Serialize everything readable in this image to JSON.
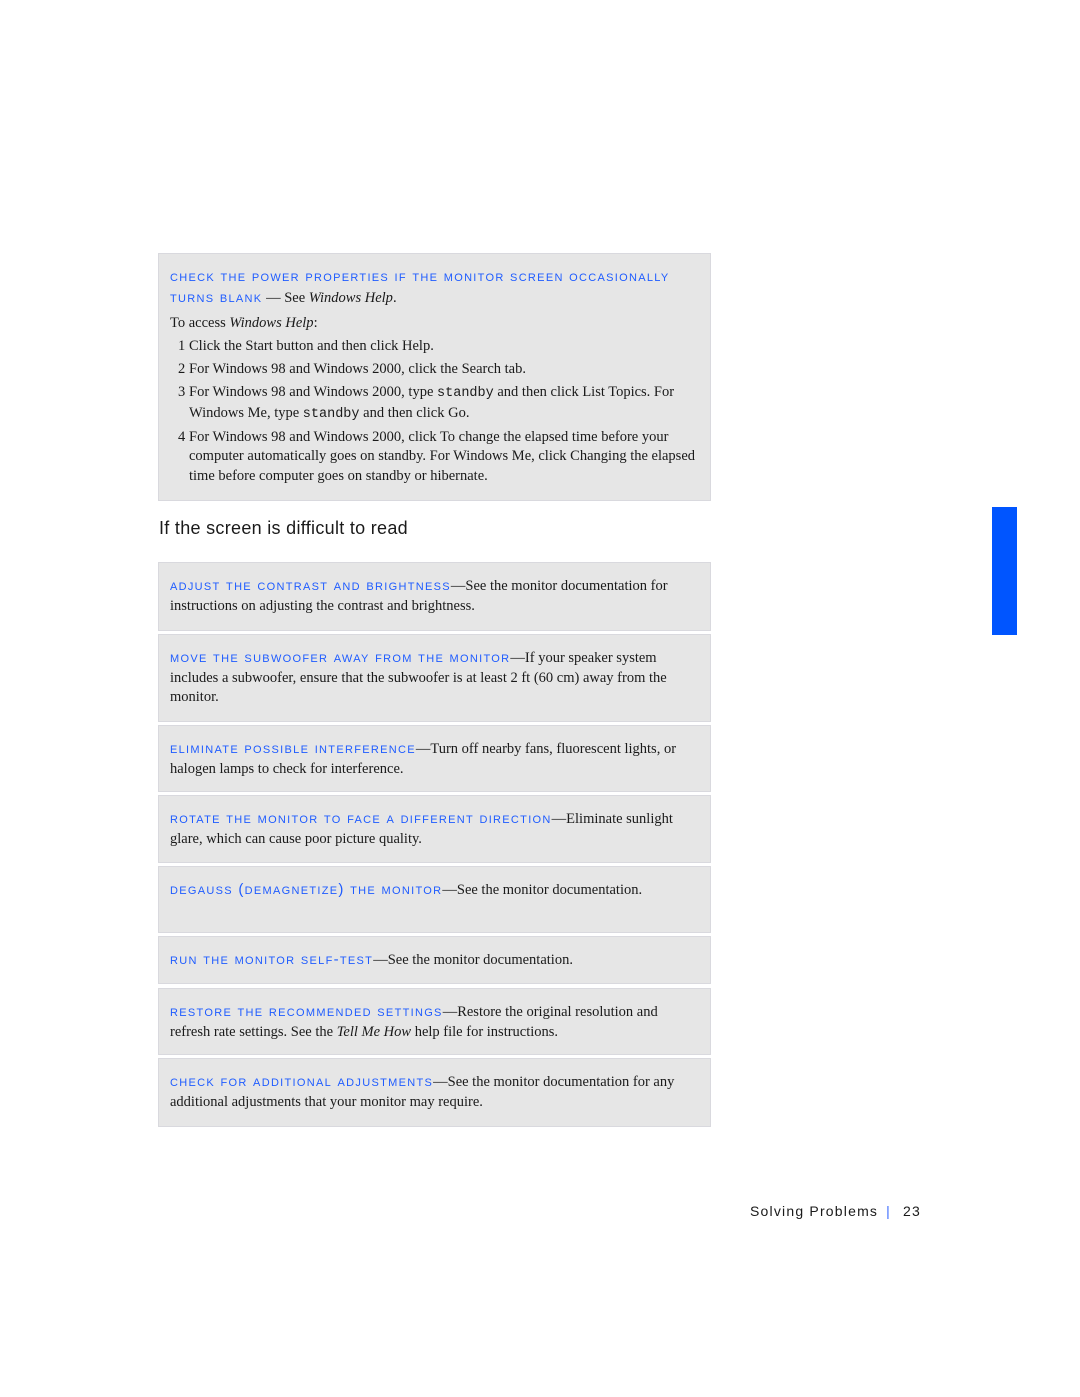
{
  "top_box": {
    "lead": "Check the Power Properties if the monitor screen occasionally turns blank",
    "lead_dash": " — ",
    "lead_rest_prefix": "See ",
    "lead_rest_italic": "Windows Help",
    "lead_rest_suffix": ".",
    "intro_prefix": "To access ",
    "intro_italic": "Windows Help",
    "intro_suffix": ":",
    "steps": [
      {
        "num": "1",
        "text": "Click the Start button and then click Help."
      },
      {
        "num": "2",
        "text": "For Windows 98 and Windows 2000, click the Search tab."
      },
      {
        "num": "3",
        "text_a": "For Windows 98 and Windows 2000, type ",
        "code_a": "standby",
        "text_b": " and then click List Topics. For Windows Me, type ",
        "code_b": "standby",
        "text_c": " and then click Go."
      },
      {
        "num": "4",
        "text": "For Windows 98 and Windows 2000, click To change the elapsed time before your computer automatically goes on standby. For Windows Me, click Changing the elapsed time before computer goes on standby or hibernate."
      }
    ]
  },
  "section_heading": "If the screen is difficult to read",
  "tips": [
    {
      "lead": "Adjust the contrast and brightness",
      "text": "—See the monitor documentation for instructions on adjusting the contrast and brightness."
    },
    {
      "lead": "Move the subwoofer away from the monitor",
      "text": "—If your speaker system includes a subwoofer, ensure that the subwoofer is at least 2 ft (60 cm) away from the monitor."
    },
    {
      "lead": "Eliminate possible interference",
      "text": "—Turn off nearby fans, fluorescent lights, or halogen lamps to check for interference."
    },
    {
      "lead": "Rotate the monitor to face a different direction",
      "text": "—Eliminate sunlight glare, which can cause poor picture quality."
    },
    {
      "lead": "Degauss (demagnetize) the monitor",
      "text": "—See the monitor documentation."
    },
    {
      "lead": "Run the monitor self-test",
      "text": "—See the monitor documentation."
    },
    {
      "lead": "Restore the recommended settings",
      "text_a": "—Restore the original resolution and refresh rate settings. See the ",
      "italic": "Tell Me How",
      "text_b": " help file for instructions."
    },
    {
      "lead": "Check for additional adjustments",
      "text": "—See the monitor documentation for any additional adjustments that your monitor may require."
    }
  ],
  "footer": {
    "section": "Solving Problems",
    "separator": "|",
    "page_number": "23"
  },
  "colors": {
    "accent": "#1f5cff",
    "tab": "#0055ff",
    "box_bg": "#e6e6e6"
  }
}
